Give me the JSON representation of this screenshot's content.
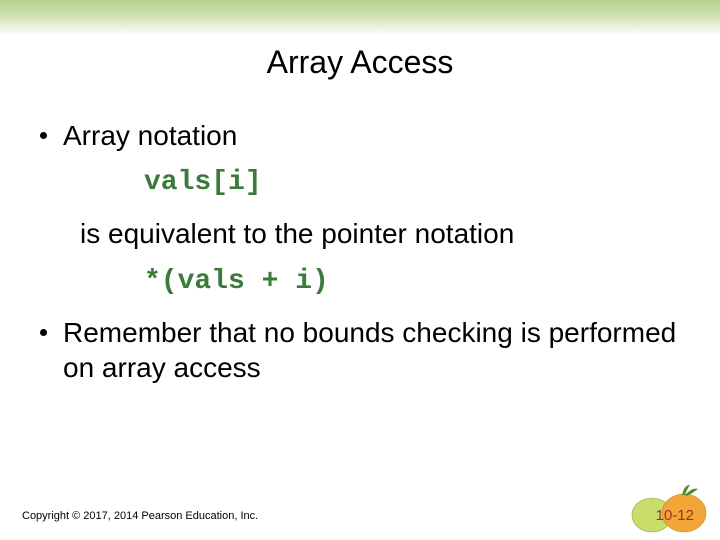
{
  "title": "Array Access",
  "bullets": [
    {
      "lead": "Array notation",
      "code1": "vals[i]",
      "mid": "is equivalent to the pointer notation",
      "code2": "*(vals + i)"
    },
    {
      "text": "Remember that no bounds checking is performed on array access"
    }
  ],
  "footer": {
    "copyright": "Copyright © 2017, 2014 Pearson Education, Inc.",
    "pagenum": "10-12"
  }
}
